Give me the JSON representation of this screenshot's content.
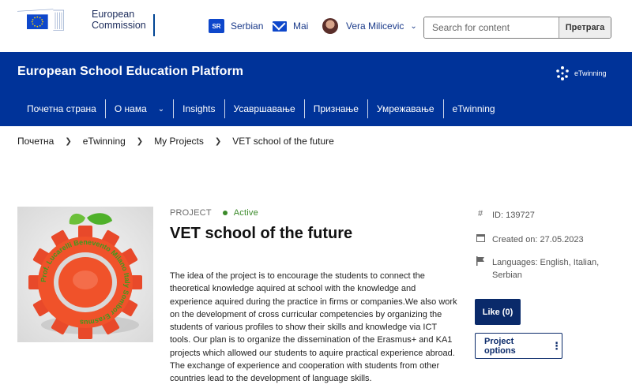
{
  "top": {
    "org_line1": "European",
    "org_line2": "Commission",
    "lang_code": "SR",
    "lang_label": "Serbian",
    "mail_label": "Mai",
    "user_name": "Vera Milicevic",
    "search_placeholder": "Search for content",
    "search_button": "Претрага"
  },
  "header": {
    "site_title": "European School Education Platform",
    "etwinning_label": "eTwinning"
  },
  "nav": [
    {
      "label": "Почетна страна"
    },
    {
      "label": "О нама"
    },
    {
      "label": "Insights"
    },
    {
      "label": "Усавршавање"
    },
    {
      "label": "Признање"
    },
    {
      "label": "Умрежавање"
    },
    {
      "label": "eTwinning"
    }
  ],
  "breadcrumb": [
    "Почетна",
    "eTwinning",
    "My Projects",
    "VET school of the future"
  ],
  "project": {
    "kind": "PROJECT",
    "status": "Active",
    "title": "VET school of the future",
    "description": "The idea of the project is to encourage the students to connect the theoretical knowledge aquired at school with the knowledge and experience aquired during the practice in firms or companies.We also work on the development of cross curricular competencies by organizing the students of various profiles to show their skills and knowledge via ICT tools. Our plan is to organize the dissemination of the Erasmus+ and KA1 projects which allowed our students to aquire practical experience abroad. The exchange of experience and cooperation with students from other countries lead to the development of language skills.",
    "image_text": "Prof. Lucarelli Benevento Milano Italy Sombor Erasmus",
    "id_label": "ID: 139727",
    "created_label": "Created on: 27.05.2023",
    "languages_label": "Languages: English, Italian, Serbian",
    "like_button": "Like (0)",
    "options_button": "Project options"
  },
  "colors": {
    "brand_blue": "#003399",
    "button_navy": "#0a2a6a",
    "status_green": "#3b8a2a",
    "gear_orange": "#f0522a",
    "leaf_green": "#4fb12a"
  },
  "icons": {
    "hash": "hash-icon",
    "calendar": "calendar-icon",
    "flag": "flag-icon",
    "kebab": "kebab-icon"
  }
}
